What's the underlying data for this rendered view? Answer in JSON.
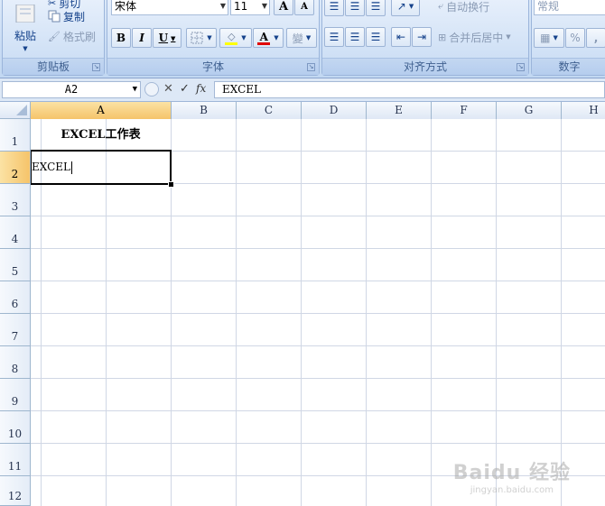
{
  "ribbon": {
    "clipboard": {
      "label": "剪贴板",
      "paste_label": "粘贴",
      "cut_label": "剪切",
      "copy_label": "复制",
      "format_painter_label": "格式刷"
    },
    "font": {
      "label": "字体",
      "font_name": "宋体",
      "font_size": "11",
      "grow_font": "A",
      "shrink_font": "A",
      "bold": "B",
      "italic": "I",
      "underline": "U",
      "font_color_glyph": "A",
      "phonetic_glyph": "變"
    },
    "alignment": {
      "label": "对齐方式",
      "wrap_text_label": "自动换行",
      "merge_center_label": "合并后居中"
    },
    "number": {
      "label": "数字",
      "format": "常规",
      "percent": "%"
    }
  },
  "formula_bar": {
    "name_box": "A2",
    "function_label": "fx",
    "cancel_glyph": "✕",
    "enter_glyph": "✓",
    "content": "EXCEL"
  },
  "sheet": {
    "columns": [
      "A",
      "B",
      "C",
      "D",
      "E",
      "F",
      "G",
      "H"
    ],
    "rows": [
      "1",
      "2",
      "3",
      "4",
      "5",
      "6",
      "7",
      "8",
      "9",
      "10",
      "11",
      "12"
    ],
    "selected_column": "A",
    "selected_row": "2",
    "cells": {
      "A1": "EXCEL工作表",
      "A2": "EXCEL"
    }
  },
  "watermark": {
    "brand": "Baidu 经验",
    "url": "jingyan.baidu.com"
  }
}
